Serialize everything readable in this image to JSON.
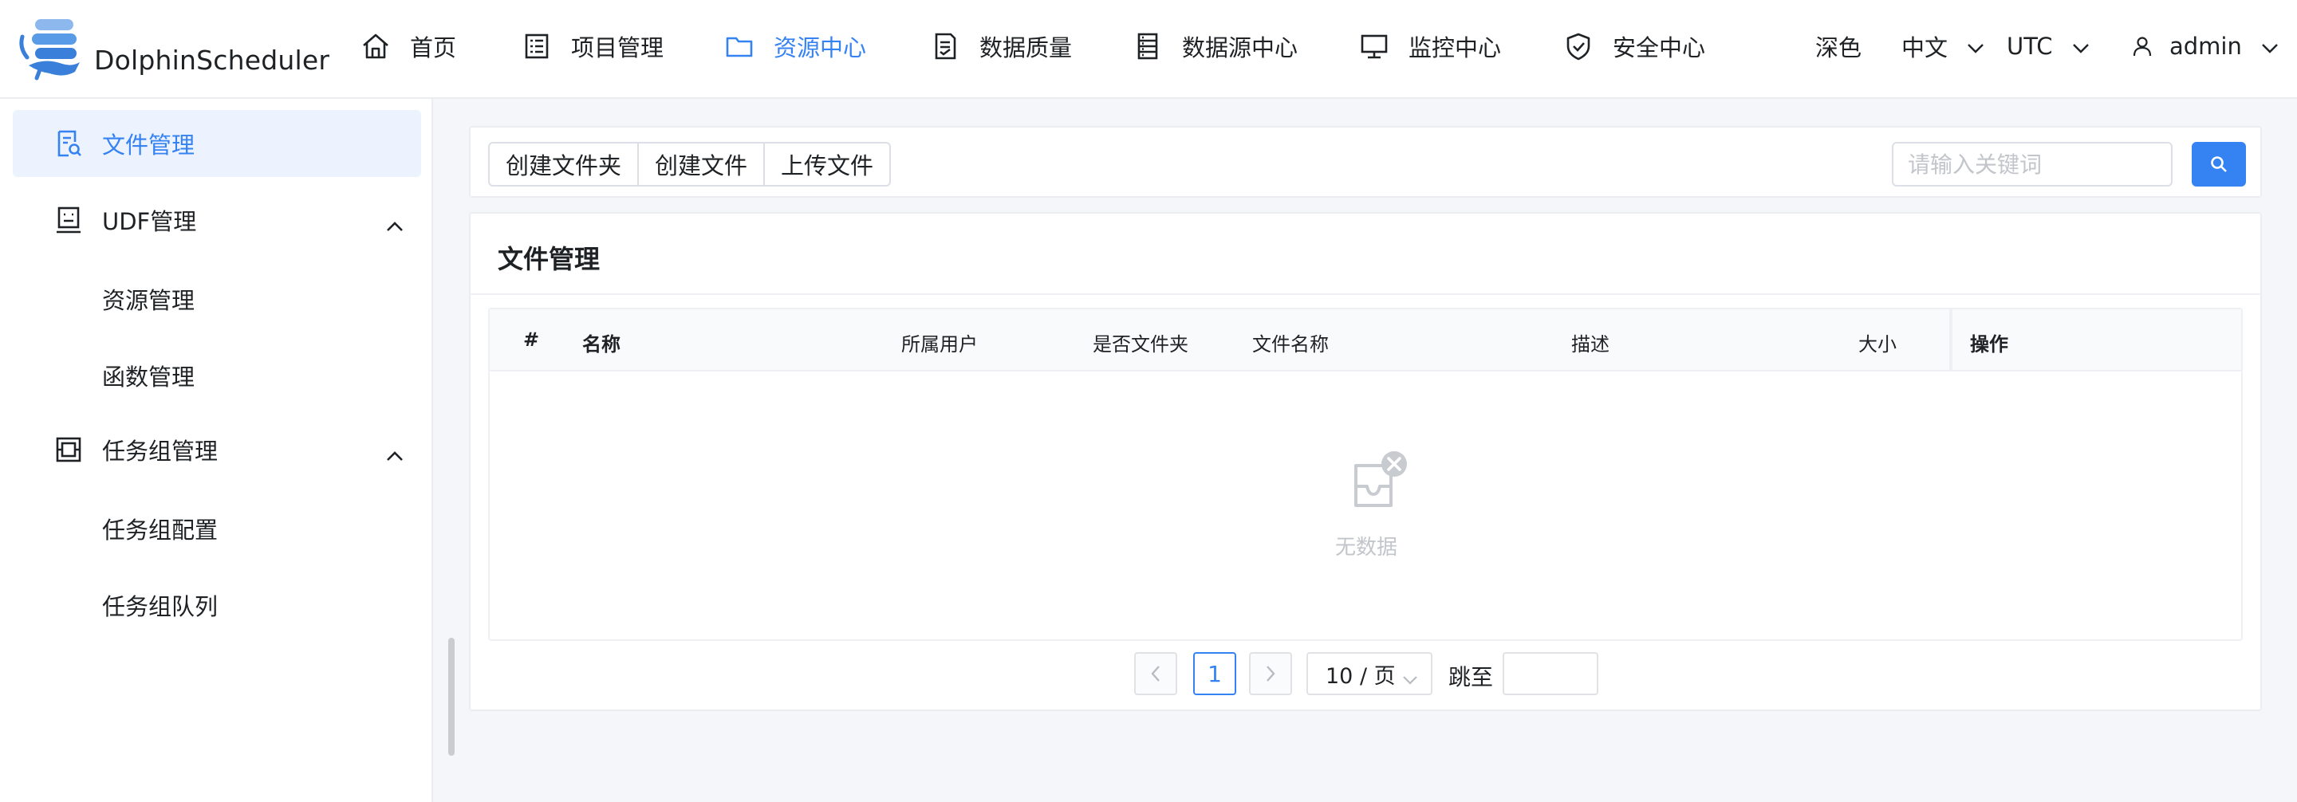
{
  "app": {
    "name": "DolphinScheduler"
  },
  "nav": {
    "items": [
      {
        "label": "首页",
        "icon": "home-icon"
      },
      {
        "label": "项目管理",
        "icon": "project-list-icon"
      },
      {
        "label": "资源中心",
        "icon": "folder-icon",
        "active": true
      },
      {
        "label": "数据质量",
        "icon": "document-check-icon"
      },
      {
        "label": "数据源中心",
        "icon": "server-icon"
      },
      {
        "label": "监控中心",
        "icon": "monitor-icon"
      },
      {
        "label": "安全中心",
        "icon": "shield-icon"
      }
    ],
    "theme_label": "深色",
    "language_label": "中文",
    "timezone_label": "UTC",
    "user_label": "admin"
  },
  "sidebar": {
    "items": [
      {
        "label": "文件管理",
        "icon": "file-search-icon",
        "active": true
      },
      {
        "label": "UDF管理",
        "icon": "udf-icon",
        "expanded": true,
        "children": [
          {
            "label": "资源管理"
          },
          {
            "label": "函数管理"
          }
        ]
      },
      {
        "label": "任务组管理",
        "icon": "task-group-icon",
        "expanded": true,
        "children": [
          {
            "label": "任务组配置"
          },
          {
            "label": "任务组队列"
          }
        ]
      }
    ]
  },
  "toolbar": {
    "create_folder": "创建文件夹",
    "create_file": "创建文件",
    "upload_file": "上传文件",
    "search_placeholder": "请输入关键词"
  },
  "card": {
    "title": "文件管理"
  },
  "table": {
    "columns": [
      "#",
      "名称",
      "所属用户",
      "是否文件夹",
      "文件名称",
      "描述",
      "大小",
      "操作"
    ],
    "rows": [],
    "empty_text": "无数据"
  },
  "pagination": {
    "current_page": "1",
    "page_size_label": "10 / 页",
    "jump_label": "跳至"
  },
  "colors": {
    "accent": "#3582f2",
    "background": "#f5f6fa",
    "active_bg": "#ecf3fe"
  }
}
